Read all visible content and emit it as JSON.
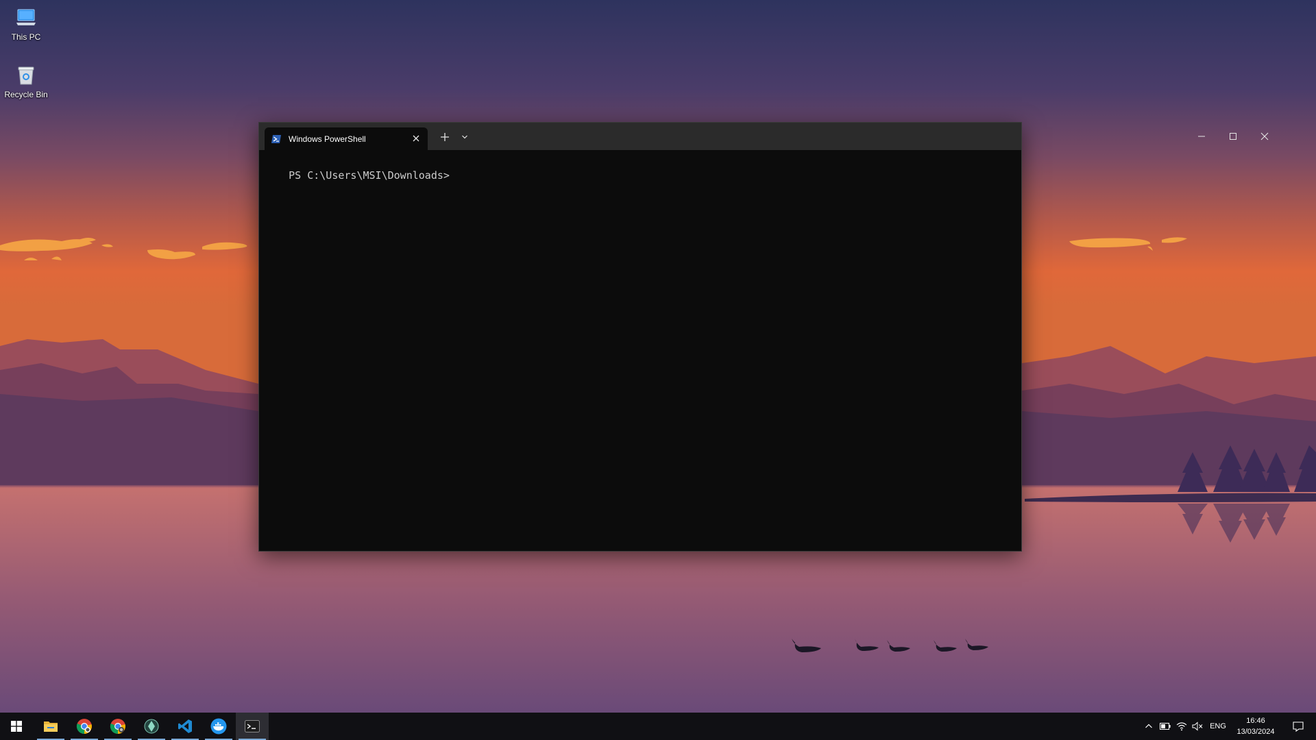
{
  "desktop": {
    "icons": [
      {
        "label": "This PC",
        "icon": "this-pc-icon"
      },
      {
        "label": "Recycle Bin",
        "icon": "recycle-bin-icon"
      }
    ]
  },
  "terminal": {
    "tab_title": "Windows PowerShell",
    "prompt": "PS C:\\Users\\MSI\\Downloads>",
    "colors": {
      "titlebar": "#2b2b2b",
      "background": "#0c0c0c",
      "text": "#cccccc"
    }
  },
  "taskbar": {
    "apps": [
      {
        "name": "File Explorer",
        "icon": "file-explorer-icon"
      },
      {
        "name": "Google Chrome",
        "icon": "chrome-icon"
      },
      {
        "name": "Google Chrome",
        "icon": "chrome-icon"
      },
      {
        "name": "App",
        "icon": "app-icon"
      },
      {
        "name": "Visual Studio Code",
        "icon": "vscode-icon"
      },
      {
        "name": "Docker",
        "icon": "docker-icon"
      },
      {
        "name": "Terminal",
        "icon": "terminal-icon"
      }
    ],
    "language": "ENG",
    "time": "16:46",
    "date": "13/03/2024"
  }
}
